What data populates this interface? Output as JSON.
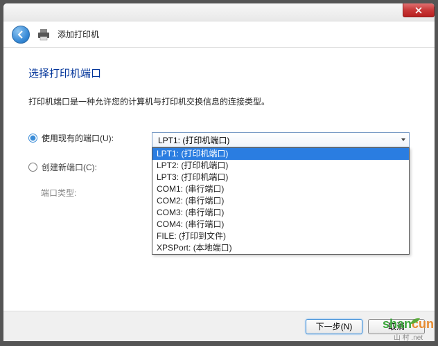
{
  "window": {
    "title": "添加打印机"
  },
  "page": {
    "heading": "选择打印机端口",
    "description": "打印机端口是一种允许您的计算机与打印机交换信息的连接类型。"
  },
  "options": {
    "use_existing": {
      "label": "使用现有的端口(U):"
    },
    "create_new": {
      "label": "创建新端口(C):"
    },
    "port_type_label": "端口类型:"
  },
  "combo": {
    "selected": "LPT1: (打印机端口)",
    "items": [
      "LPT1: (打印机端口)",
      "LPT2: (打印机端口)",
      "LPT3: (打印机端口)",
      "COM1: (串行端口)",
      "COM2: (串行端口)",
      "COM3: (串行端口)",
      "COM4: (串行端口)",
      "FILE: (打印到文件)",
      "XPSPort: (本地端口)"
    ]
  },
  "buttons": {
    "next": "下一步(N)",
    "cancel": "取消"
  },
  "watermark": {
    "line1a": "shan",
    "line1b": "cun",
    "line2": "山 村 .net"
  }
}
